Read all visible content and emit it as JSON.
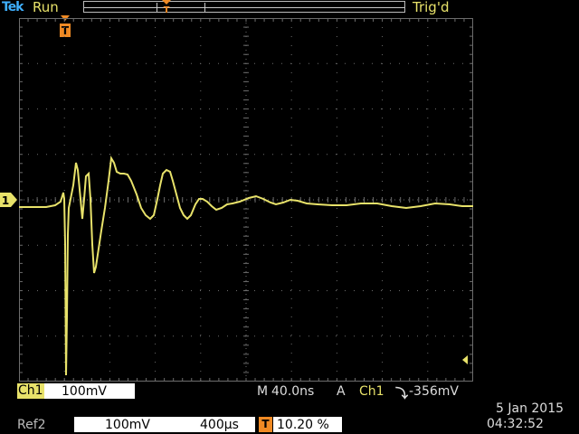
{
  "header": {
    "brand": "Tek",
    "acq_state": "Run",
    "trigger_state": "Trig'd"
  },
  "markers": {
    "trigger_position_label": "T",
    "channel1_label": "1"
  },
  "channel1": {
    "name": "Ch1",
    "scale": "100mV"
  },
  "timebase": {
    "mode": "M",
    "value": "40.0ns"
  },
  "trigger": {
    "type": "A",
    "source": "Ch1",
    "slope_symbol": "⤵",
    "level": "-356mV"
  },
  "reference": {
    "name": "Ref2",
    "scale": "100mV",
    "timebase": "400µs"
  },
  "trigger_offset": {
    "icon": "T",
    "value": "10.20 %"
  },
  "clock": {
    "date": "5 Jan  2015",
    "time": "04:32:52"
  },
  "colors": {
    "trace": "#e8e26a",
    "graticule": "#6c6c6c",
    "trigger_marker": "#f08a24",
    "brand": "#3fb0ff"
  }
}
